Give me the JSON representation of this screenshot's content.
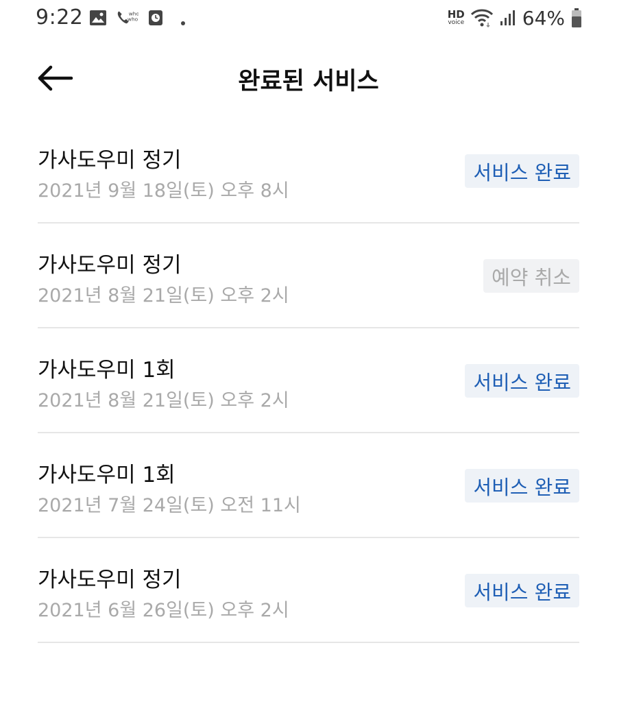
{
  "status_bar": {
    "time": "9:22",
    "hd_label": "HD",
    "voice_label": "voice",
    "battery_percent": "64%",
    "icons": [
      "gallery-icon",
      "whowho-call-icon",
      "clock-app-icon",
      "notification-dot-icon",
      "hd-voice-icon",
      "wifi-icon",
      "signal-icon",
      "battery-icon"
    ]
  },
  "header": {
    "title": "완료된 서비스",
    "back_icon": "back-arrow-icon"
  },
  "services": [
    {
      "title": "가사도우미 정기",
      "date": "2021년 9월 18일(토) 오후 8시",
      "status": "서비스 완료",
      "status_type": "done"
    },
    {
      "title": "가사도우미 정기",
      "date": "2021년 8월 21일(토) 오후 2시",
      "status": "예약 취소",
      "status_type": "cancel"
    },
    {
      "title": "가사도우미 1회",
      "date": "2021년 8월 21일(토) 오후 2시",
      "status": "서비스 완료",
      "status_type": "done"
    },
    {
      "title": "가사도우미 1회",
      "date": "2021년 7월 24일(토) 오전 11시",
      "status": "서비스 완료",
      "status_type": "done"
    },
    {
      "title": "가사도우미 정기",
      "date": "2021년 6월 26일(토) 오후 2시",
      "status": "서비스 완료",
      "status_type": "done"
    }
  ],
  "colors": {
    "done_text": "#1f5fb5",
    "done_bg": "#eef2f7",
    "cancel_text": "#a9a9a9",
    "cancel_bg": "#f1f2f4",
    "divider": "#e6e6e6"
  }
}
